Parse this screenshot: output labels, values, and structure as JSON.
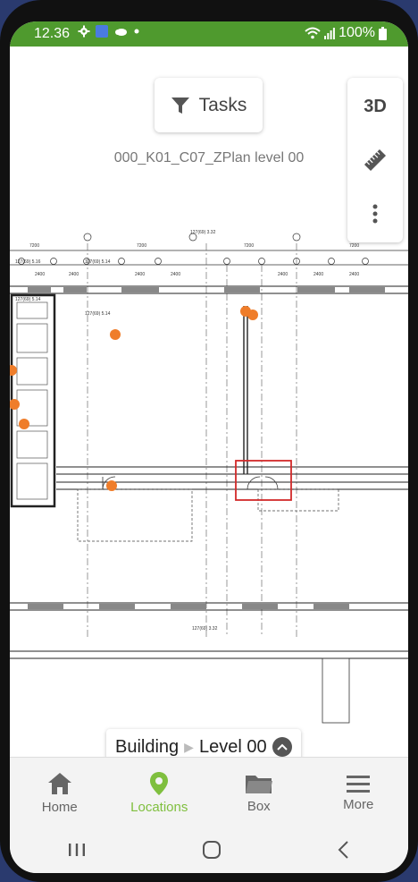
{
  "statusbar": {
    "time": "12.36",
    "battery": "100%"
  },
  "toolbar": {
    "tasks_label": "Tasks",
    "mode_3d_label": "3D"
  },
  "plan": {
    "title": "000_K01_C07_ZPlan level 00",
    "accent_color": "#ef7d2a",
    "selection_color": "#d12a2a",
    "labels": {
      "dim_7200": "7200",
      "dim_2400": "2400",
      "ref_1": "127(69) 5.16",
      "ref_2": "127(69) 5.14",
      "ref_3": "127(69) 5.14",
      "ref_4": "127(69) 3.32",
      "ref_5": "127(69) 3.32",
      "ref_6": "127(69) 5.14"
    }
  },
  "breadcrumb": {
    "building": "Building",
    "level": "Level 00"
  },
  "bottom_nav": {
    "items": [
      {
        "label": "Home",
        "icon": "home-icon"
      },
      {
        "label": "Locations",
        "icon": "location-pin-icon"
      },
      {
        "label": "Box",
        "icon": "folder-icon"
      },
      {
        "label": "More",
        "icon": "hamburger-menu-icon"
      }
    ],
    "active_color": "#7fbf3e"
  }
}
